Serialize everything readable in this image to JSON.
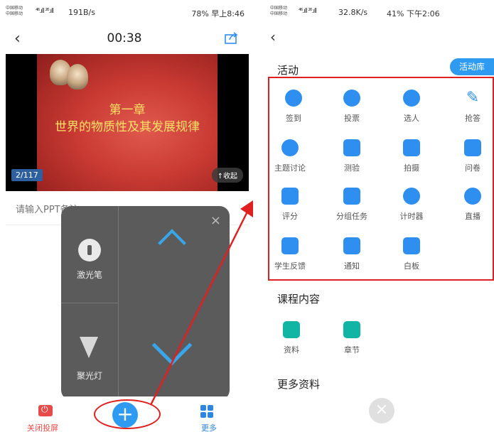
{
  "left": {
    "status": {
      "carrier1": "中国移动",
      "carrier2": "中国移动",
      "signal": "⁴⁶.ıll ²⁶.ıll",
      "speed": "191B/s",
      "right": "78% 早上8:46"
    },
    "timer": "00:38",
    "slide": {
      "title1": "第一章",
      "title2": "世界的物质性及其发展规律",
      "page": "2/117",
      "collapse": "↑收起"
    },
    "note_placeholder": "请输入PPT备注",
    "panel": {
      "close": "×",
      "laser": "激光笔",
      "spotlight": "聚光灯"
    },
    "bottom": {
      "close_projection": "关闭投屏",
      "add": "+",
      "more": "更多"
    }
  },
  "right": {
    "status": {
      "carrier1": "中国移动",
      "carrier2": "中国移动",
      "signal": "⁴⁶.ıll ²⁶.ıll",
      "speed": "32.8K/s",
      "right": "41% 下午2:06"
    },
    "activities_title": "活动",
    "library_button": "活动库",
    "activities": [
      {
        "label": "签到",
        "icon": "sign-in-icon"
      },
      {
        "label": "投票",
        "icon": "vote-icon"
      },
      {
        "label": "选人",
        "icon": "pick-person-icon"
      },
      {
        "label": "抢答",
        "icon": "quick-answer-icon"
      },
      {
        "label": "主题讨论",
        "icon": "discussion-icon"
      },
      {
        "label": "测验",
        "icon": "quiz-icon"
      },
      {
        "label": "拍摄",
        "icon": "camera-icon"
      },
      {
        "label": "问卷",
        "icon": "questionnaire-icon"
      },
      {
        "label": "评分",
        "icon": "rating-icon"
      },
      {
        "label": "分组任务",
        "icon": "group-task-icon"
      },
      {
        "label": "计时器",
        "icon": "timer-icon"
      },
      {
        "label": "直播",
        "icon": "live-icon"
      },
      {
        "label": "学生反馈",
        "icon": "feedback-icon"
      },
      {
        "label": "通知",
        "icon": "notice-icon"
      },
      {
        "label": "白板",
        "icon": "whiteboard-icon"
      }
    ],
    "course_title": "课程内容",
    "course_items": [
      {
        "label": "资料",
        "icon": "folder-icon"
      },
      {
        "label": "章节",
        "icon": "chapter-icon"
      }
    ],
    "more_title": "更多资料",
    "close": "×"
  },
  "colors": {
    "accent": "#2e9bf0",
    "highlight": "#e02020",
    "panel": "#5b5b5b",
    "teal": "#12b5a4"
  }
}
